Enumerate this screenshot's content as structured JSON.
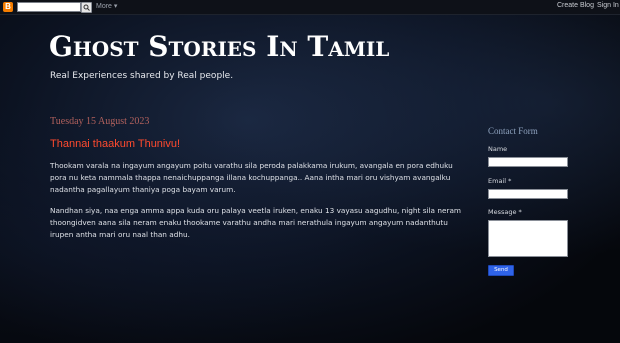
{
  "navbar": {
    "logo_letter": "B",
    "more_label": "More ▾",
    "create_blog_label": "Create Blog",
    "sign_in_label": "Sign In"
  },
  "header": {
    "title": "Ghost Stories In Tamil",
    "description": "Real Experiences shared by Real people."
  },
  "post": {
    "date": "Tuesday 15 August 2023",
    "title": "Thannai thaakum Thunivu!",
    "paragraphs": [
      " Thookam varala na ingayum angayum poitu varathu sila peroda palakkama irukum, avangala en pora edhuku pora nu keta nammala thappa nenaichuppanga illana kochuppanga.. Aana intha mari oru vishyam avangalku nadantha pagallayum thaniya poga bayam varum.",
      "Nandhan siya, naa enga amma appa kuda oru palaya veetla iruken, enaku 13 vayasu aagudhu, night sila neram thoongidven aana sila neram enaku thookame varathu andha mari nerathula ingayum angayum nadanthutu irupen antha mari oru naal than adhu."
    ]
  },
  "sidebar": {
    "contact_title": "Contact Form",
    "name_label": "Name",
    "email_label": "Email *",
    "message_label": "Message *",
    "send_label": "Send"
  },
  "colors": {
    "date": "#b0605c",
    "post_title": "#ff4a2e",
    "sidebar_title": "#8fa3bf",
    "send_button": "#2f63e8"
  }
}
